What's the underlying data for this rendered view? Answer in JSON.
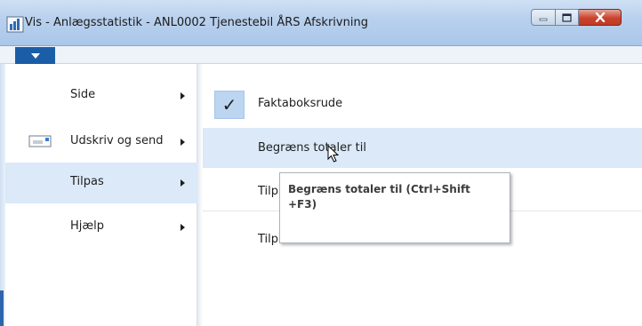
{
  "window": {
    "title": "Vis - Anlægsstatistik - ANL0002 Tjenestebil ÅRS Afskrivning",
    "app_icon": "chart-icon",
    "controls": [
      "minimize-icon",
      "maximize-icon",
      "close-icon"
    ]
  },
  "ribbon": {
    "file_tab_icon": "chevron-down-icon"
  },
  "left_menu": {
    "items": [
      {
        "label": "Side",
        "icon": null,
        "selected": false
      },
      {
        "label": "Udskriv og send",
        "icon": "print-icon",
        "selected": false
      },
      {
        "label": "Tilpas",
        "icon": null,
        "selected": true
      },
      {
        "label": "Hjælp",
        "icon": null,
        "selected": false
      }
    ]
  },
  "submenu": {
    "items": [
      {
        "label": "Faktaboksrude",
        "checked": true
      },
      {
        "label": "Begræns totaler til",
        "hover": true
      },
      {
        "label": "Tilp"
      },
      {
        "label": "Tilp"
      }
    ]
  },
  "tooltip": {
    "text": "Begræns totaler til (Ctrl+Shift +F3)"
  },
  "colors": {
    "selection": "#dbe9f8",
    "file_tab": "#1c5da8",
    "close_button": "#c9432e"
  }
}
